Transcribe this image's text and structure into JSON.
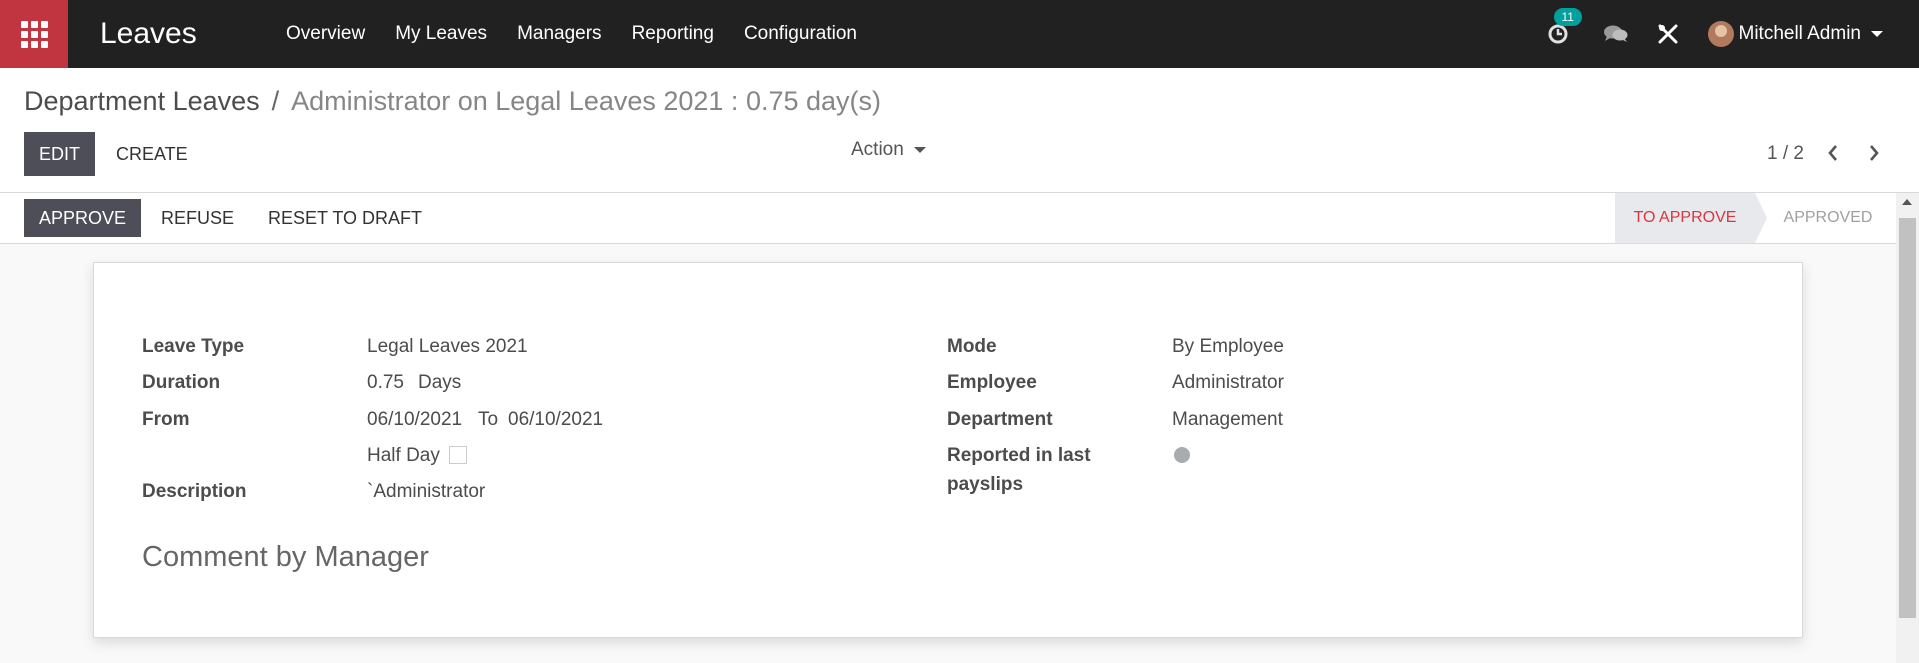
{
  "navbar": {
    "brand": "Leaves",
    "menu": [
      "Overview",
      "My Leaves",
      "Managers",
      "Reporting",
      "Configuration"
    ],
    "activity_count": "11",
    "user_name": "Mitchell Admin",
    "icons": [
      "apps-grid-icon",
      "clock-icon",
      "chat-icon",
      "tools-icon"
    ]
  },
  "breadcrumb": {
    "parent": "Department Leaves",
    "separator": "/",
    "current": "Administrator on Legal Leaves 2021 : 0.75 day(s)"
  },
  "buttons": {
    "edit": "EDIT",
    "create": "CREATE",
    "action": "Action"
  },
  "pager": {
    "value": "1 / 2"
  },
  "statusbar": {
    "approve": "APPROVE",
    "refuse": "REFUSE",
    "reset": "RESET TO DRAFT",
    "stage_current": "TO APPROVE",
    "stage_next": "APPROVED"
  },
  "colors": {
    "navbar_bg": "#212121",
    "apps_button_bg": "#c0353f",
    "badge_bg": "#00a09d",
    "dark_button_bg": "#4e4e58",
    "current_stage_text": "#d9363e"
  },
  "form": {
    "left": {
      "leave_type_label": "Leave Type",
      "leave_type_value": "Legal Leaves 2021",
      "duration_label": "Duration",
      "duration_value": "0.75",
      "duration_unit": "Days",
      "from_label": "From",
      "from_date": "06/10/2021",
      "to_label": "To",
      "to_date": "06/10/2021",
      "half_day_label": "Half Day",
      "description_label": "Description",
      "description_value": "`Administrator"
    },
    "right": {
      "mode_label": "Mode",
      "mode_value": "By Employee",
      "employee_label": "Employee",
      "employee_value": "Administrator",
      "department_label": "Department",
      "department_value": "Management",
      "reported_label_line1": "Reported in last",
      "reported_label_line2": "payslips"
    },
    "comment_heading": "Comment by Manager"
  }
}
